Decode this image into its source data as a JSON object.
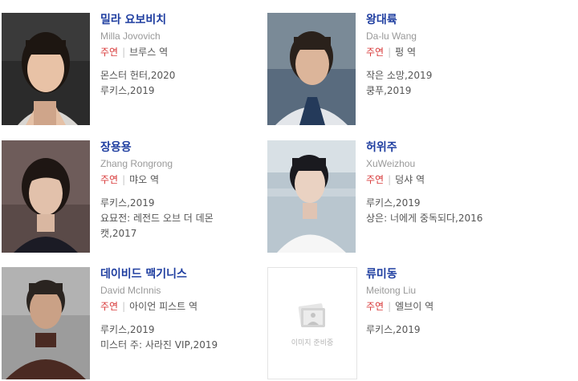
{
  "cast": [
    {
      "name_ko": "밀라 요보비치",
      "name_en": "Milla Jovovich",
      "role_label": "주연",
      "role": "브루스 역",
      "works": [
        "몬스터 헌터,2020",
        "루키스,2019"
      ]
    },
    {
      "name_ko": "왕대륙",
      "name_en": "Da-lu Wang",
      "role_label": "주연",
      "role": "펑 역",
      "works": [
        "작은 소망,2019",
        "쿵푸,2019"
      ]
    },
    {
      "name_ko": "장용용",
      "name_en": "Zhang Rongrong",
      "role_label": "주연",
      "role": "먀오 역",
      "works": [
        "루키스,2019",
        "요묘전: 레전드 오브 더 데몬",
        "캣,2017"
      ]
    },
    {
      "name_ko": "허위주",
      "name_en": "XuWeizhou",
      "role_label": "주연",
      "role": "덩샤 역",
      "works": [
        "루키스,2019",
        "상은: 너에게 중독되다,2016"
      ]
    },
    {
      "name_ko": "데이비드 맥기니스",
      "name_en": "David McInnis",
      "role_label": "주연",
      "role": "아이언 피스트 역",
      "works": [
        "루키스,2019",
        "미스터 주: 사라진 VIP,2019"
      ]
    },
    {
      "name_ko": "류미동",
      "name_en": "Meitong Liu",
      "role_label": "주연",
      "role": "엘브이 역",
      "works": [
        "루키스,2019"
      ],
      "placeholder_text": "이미지 준비중"
    }
  ]
}
